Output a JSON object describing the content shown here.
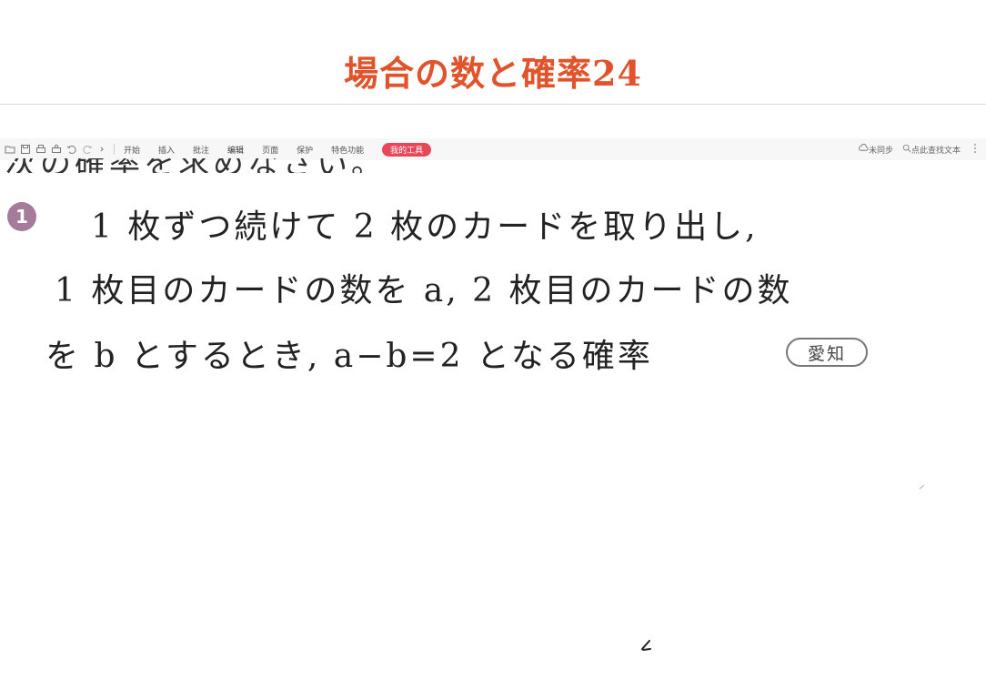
{
  "header": {
    "title": "場合の数と確率24"
  },
  "toolbar": {
    "quick_icons": [
      "open-icon",
      "save-icon",
      "print-icon",
      "print-preview-icon",
      "undo-icon",
      "redo-icon",
      "more-icon"
    ],
    "tabs": [
      "开始",
      "插入",
      "批注",
      "编辑",
      "页面",
      "保护",
      "特色功能"
    ],
    "highlight_tab": "我的工具",
    "sync_label": "未同步",
    "find_label": "点此查找文本"
  },
  "document": {
    "cut_line": "次の確率を求めなさい。",
    "question_number": "1",
    "lines": [
      "1 枚ずつ続けて 2 枚のカードを取り出し,",
      "1 枚目のカードの数を a, 2 枚目のカードの数",
      "を b とするとき, a−b=2 となる確率"
    ],
    "source_badge": "愛知"
  },
  "colors": {
    "title": "#e0532b",
    "question_badge": "#a47b98",
    "highlight_tab": "#e8475a"
  }
}
